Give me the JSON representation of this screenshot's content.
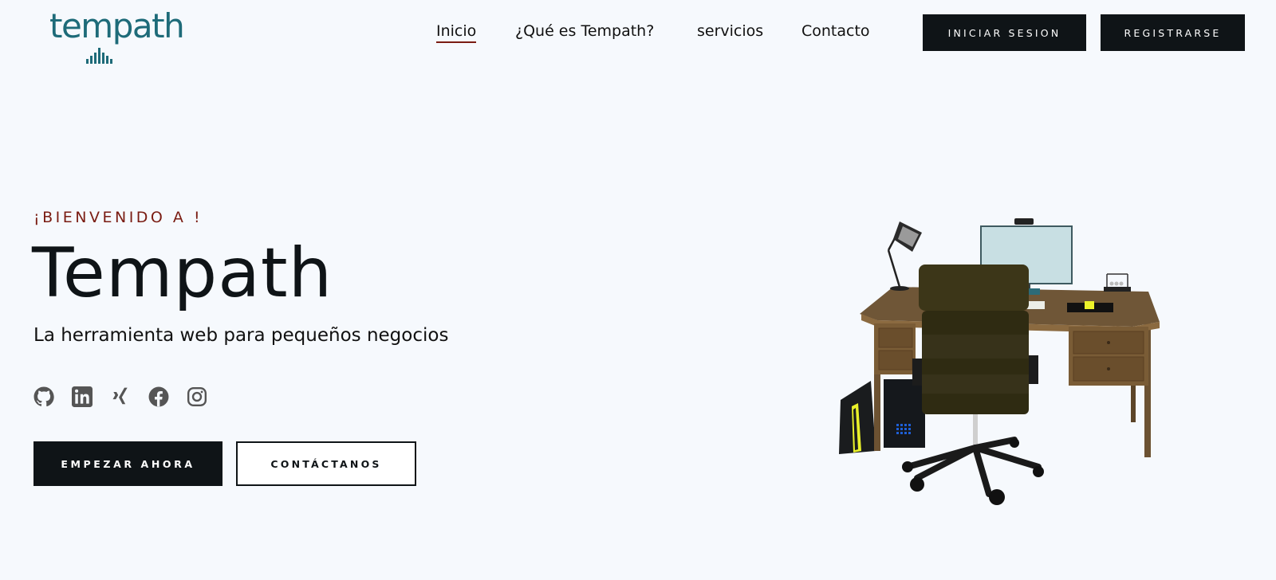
{
  "brand": {
    "logo_text": "tempath",
    "accent": "#1e6b79"
  },
  "nav": {
    "items": [
      {
        "label": "Inicio",
        "active": true
      },
      {
        "label": "¿Qué es Tempath?",
        "active": false
      },
      {
        "label": "servicios",
        "active": false
      },
      {
        "label": "Contacto",
        "active": false
      }
    ],
    "login_label": "INICIAR SESION",
    "register_label": "REGISTRARSE"
  },
  "hero": {
    "welcome": "¡BIENVENIDO A !",
    "title": "Tempath",
    "subtitle": "La herramienta web para pequeños negocios",
    "primary_cta": "EMPEZAR AHORA",
    "secondary_cta": "CONTÁCTANOS",
    "socials": [
      "github-icon",
      "linkedin-icon",
      "xing-icon",
      "facebook-icon",
      "instagram-icon"
    ]
  },
  "colors": {
    "dark": "#0f1417",
    "welcome": "#7a1c12",
    "background": "#f6f9fd"
  }
}
